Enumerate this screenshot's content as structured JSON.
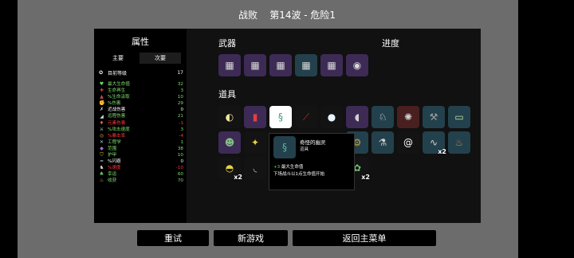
{
  "header": {
    "title": "战败    第14波 - 危险1"
  },
  "stats_panel": {
    "title": "属性",
    "tabs": [
      "主要",
      "次要"
    ],
    "level": {
      "label": "目前等级",
      "value": "17"
    },
    "colors": {
      "green": "#7ee06e",
      "red": "#ff3a3a",
      "white": "#ffffff"
    },
    "stats": [
      {
        "icon": "heart-icon",
        "glyph": "♥",
        "icon_color": "#6ed46e",
        "label": "最大生命值",
        "value": "32",
        "tone": "green"
      },
      {
        "icon": "cross-icon",
        "glyph": "✚",
        "icon_color": "#e04040",
        "label": "生命再生",
        "value": "3",
        "tone": "green"
      },
      {
        "icon": "vampire-icon",
        "glyph": "▲",
        "icon_color": "#d04848",
        "label": "%生命汲取",
        "value": "10",
        "tone": "green"
      },
      {
        "icon": "fist-icon",
        "glyph": "✊",
        "icon_color": "#f0c890",
        "label": "%伤害",
        "value": "29",
        "tone": "green"
      },
      {
        "icon": "sword-icon",
        "glyph": "✗",
        "icon_color": "#dddddd",
        "label": "近战伤害",
        "value": "0",
        "tone": "white"
      },
      {
        "icon": "gun-icon",
        "glyph": "◢",
        "icon_color": "#dddddd",
        "label": "远程伤害",
        "value": "21",
        "tone": "green"
      },
      {
        "icon": "flame-icon",
        "glyph": "♦",
        "icon_color": "#e07030",
        "label": "元素伤害",
        "value": "-1",
        "tone": "red"
      },
      {
        "icon": "attack-speed-icon",
        "glyph": "⚔",
        "icon_color": "#dddddd",
        "label": "%攻击速度",
        "value": "3",
        "tone": "green"
      },
      {
        "icon": "crit-icon",
        "glyph": "◎",
        "icon_color": "#e0a030",
        "label": "%暴击率",
        "value": "-4",
        "tone": "red"
      },
      {
        "icon": "wrench-icon",
        "glyph": "✕",
        "icon_color": "#9ad0e0",
        "label": "工程学",
        "value": "1",
        "tone": "green"
      },
      {
        "icon": "range-icon",
        "glyph": "◆",
        "icon_color": "#b070d0",
        "label": "范围",
        "value": "38",
        "tone": "green"
      },
      {
        "icon": "shield-icon",
        "glyph": "⛉",
        "icon_color": "#e0d040",
        "label": "护甲",
        "value": "10",
        "tone": "green"
      },
      {
        "icon": "dodge-icon",
        "glyph": "≈",
        "icon_color": "#dddddd",
        "label": "%闪避",
        "value": "0",
        "tone": "white"
      },
      {
        "icon": "boot-icon",
        "glyph": "♞",
        "icon_color": "#e0e0e0",
        "label": "%速度",
        "value": "-10",
        "tone": "red"
      },
      {
        "icon": "clover-icon",
        "glyph": "♣",
        "icon_color": "#6ed46e",
        "label": "幸运",
        "value": "60",
        "tone": "green"
      },
      {
        "icon": "harvest-icon",
        "glyph": "♨",
        "icon_color": "#e0c060",
        "label": "收获",
        "value": "70",
        "tone": "green"
      }
    ]
  },
  "weapons": {
    "title": "武器",
    "items": [
      {
        "name": "minigun-icon",
        "glyph": "▦",
        "tier": "wpn"
      },
      {
        "name": "minigun-icon",
        "glyph": "▦",
        "tier": "wpn"
      },
      {
        "name": "minigun-icon",
        "glyph": "▦",
        "tier": "wpn"
      },
      {
        "name": "minigun-icon",
        "glyph": "▦",
        "tier": "wpn-t"
      },
      {
        "name": "minigun-icon",
        "glyph": "▦",
        "tier": "wpn"
      },
      {
        "name": "gatling-icon",
        "glyph": "◉",
        "tier": "wpn"
      }
    ]
  },
  "progress": {
    "title": "进度"
  },
  "items": {
    "title": "道具",
    "slots": [
      {
        "name": "egg-icon",
        "glyph": "◐",
        "tier": "t-white",
        "color": "#f0e8a0"
      },
      {
        "name": "fuel-can-icon",
        "glyph": "▮",
        "tier": "t-purple",
        "color": "#e04040"
      },
      {
        "name": "ghost-icon",
        "glyph": "§",
        "tier": "t-sel",
        "color": "#3a9a78"
      },
      {
        "name": "rifle-icon",
        "glyph": "⟋",
        "tier": "t-white",
        "color": "#c03030"
      },
      {
        "name": "snowball-icon",
        "glyph": "●",
        "tier": "t-white",
        "color": "#e8f4ff"
      },
      {
        "name": "bottle-icon",
        "glyph": "◖",
        "tier": "t-purple",
        "color": "#d0d0d0"
      },
      {
        "name": "rabbit-icon",
        "glyph": "♘",
        "tier": "t-blue",
        "color": "#e8e8e8"
      },
      {
        "name": "eye-icon",
        "glyph": "✺",
        "tier": "t-red",
        "color": "#d0d0d0"
      },
      {
        "name": "cart-icon",
        "glyph": "⚒",
        "tier": "t-blue",
        "color": "#a0a0a0"
      },
      {
        "name": "battery-icon",
        "glyph": "▭",
        "tier": "t-blue",
        "color": "#c0e0a0"
      },
      {
        "name": "alien-icon",
        "glyph": "☻",
        "tier": "t-purple",
        "color": "#80c080"
      },
      {
        "name": "bird-icon",
        "glyph": "✦",
        "tier": "t-white",
        "color": "#e8d040"
      },
      {
        "name": "blank",
        "glyph": "",
        "tier": "t-white",
        "color": "#ffffff"
      },
      {
        "name": "blank",
        "glyph": "",
        "tier": "t-white",
        "color": "#ffffff"
      },
      {
        "name": "gear-icon",
        "glyph": "⚙",
        "tier": "t-blue",
        "color": "#c0a040"
      },
      {
        "name": "potion-icon",
        "glyph": "⚗",
        "tier": "t-blue",
        "color": "#d0d0d0"
      },
      {
        "name": "snail-icon",
        "glyph": "@",
        "tier": "t-white",
        "color": "#ffffff"
      },
      {
        "name": "worm-icon",
        "glyph": "∿",
        "tier": "t-blue",
        "color": "#d0d0d0"
      },
      {
        "name": "poop-icon",
        "glyph": "♨",
        "tier": "t-blue",
        "color": "#b08050"
      },
      {
        "name": "duck-icon",
        "glyph": "◓",
        "tier": "t-white",
        "color": "#e8d040"
      },
      {
        "name": "claw-icon",
        "glyph": "◟",
        "tier": "t-white",
        "color": "#c0c0c0"
      },
      {
        "name": "leaf-icon",
        "glyph": "✿",
        "tier": "t-white",
        "color": "#70c070"
      }
    ],
    "counts": [
      "x2",
      "x2",
      "x2"
    ]
  },
  "tooltip": {
    "name": "奇怪的幽灵",
    "type": "道具",
    "effect_value": "+3",
    "effect_label": "最大生命值",
    "description": "下场战斗以1点生命值开始"
  },
  "buttons": {
    "retry": "重试",
    "new_game": "新游戏",
    "main_menu": "返回主菜单"
  }
}
